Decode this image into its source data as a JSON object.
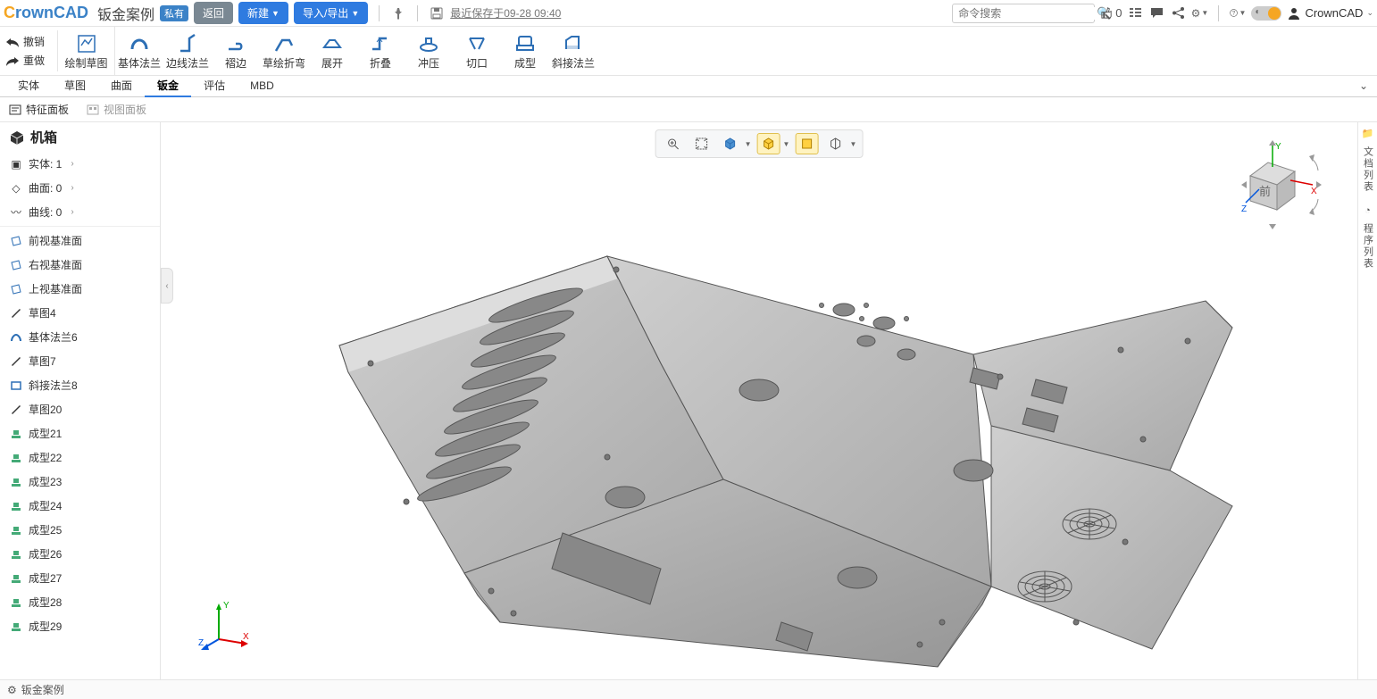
{
  "header": {
    "logo_prefix": "C",
    "logo_main": "rownCAD",
    "doc_title": "钣金案例",
    "badge": "私有",
    "btn_back": "返回",
    "btn_new": "新建",
    "btn_io": "导入/导出",
    "last_saved": "最近保存于09-28 09:40",
    "search_placeholder": "命令搜索",
    "like_count": "0",
    "username": "CrownCAD"
  },
  "ribbon": {
    "undo": "撤销",
    "redo": "重做",
    "sketch": "绘制草图",
    "items": [
      {
        "label": "基体法兰"
      },
      {
        "label": "边线法兰"
      },
      {
        "label": "褶边"
      },
      {
        "label": "草绘折弯"
      },
      {
        "label": "展开"
      },
      {
        "label": "折叠"
      },
      {
        "label": "冲压"
      },
      {
        "label": "切口"
      },
      {
        "label": "成型"
      },
      {
        "label": "斜接法兰"
      }
    ]
  },
  "tabs": [
    "实体",
    "草图",
    "曲面",
    "钣金",
    "评估",
    "MBD"
  ],
  "tabs_active_index": 3,
  "panel_tabs": {
    "feature": "特征面板",
    "view": "视图面板"
  },
  "tree": {
    "title": "机箱",
    "stats": [
      {
        "label": "实体: 1"
      },
      {
        "label": "曲面: 0"
      },
      {
        "label": "曲线: 0"
      }
    ],
    "planes": [
      "前视基准面",
      "右视基准面",
      "上视基准面"
    ],
    "features": [
      {
        "type": "sketch",
        "label": "草图4"
      },
      {
        "type": "flange",
        "label": "基体法兰6"
      },
      {
        "type": "sketch",
        "label": "草图7"
      },
      {
        "type": "miter",
        "label": "斜接法兰8"
      },
      {
        "type": "sketch",
        "label": "草图20"
      },
      {
        "type": "form",
        "label": "成型21"
      },
      {
        "type": "form",
        "label": "成型22"
      },
      {
        "type": "form",
        "label": "成型23"
      },
      {
        "type": "form",
        "label": "成型24"
      },
      {
        "type": "form",
        "label": "成型25"
      },
      {
        "type": "form",
        "label": "成型26"
      },
      {
        "type": "form",
        "label": "成型27"
      },
      {
        "type": "form",
        "label": "成型28"
      },
      {
        "type": "form",
        "label": "成型29"
      }
    ]
  },
  "right_panels": {
    "docs": "文档列表",
    "prog": "程序列表"
  },
  "footer": {
    "label": "钣金案例"
  },
  "nav_cube": {
    "face": "前",
    "x": "X",
    "y": "Y",
    "z": "Z"
  }
}
